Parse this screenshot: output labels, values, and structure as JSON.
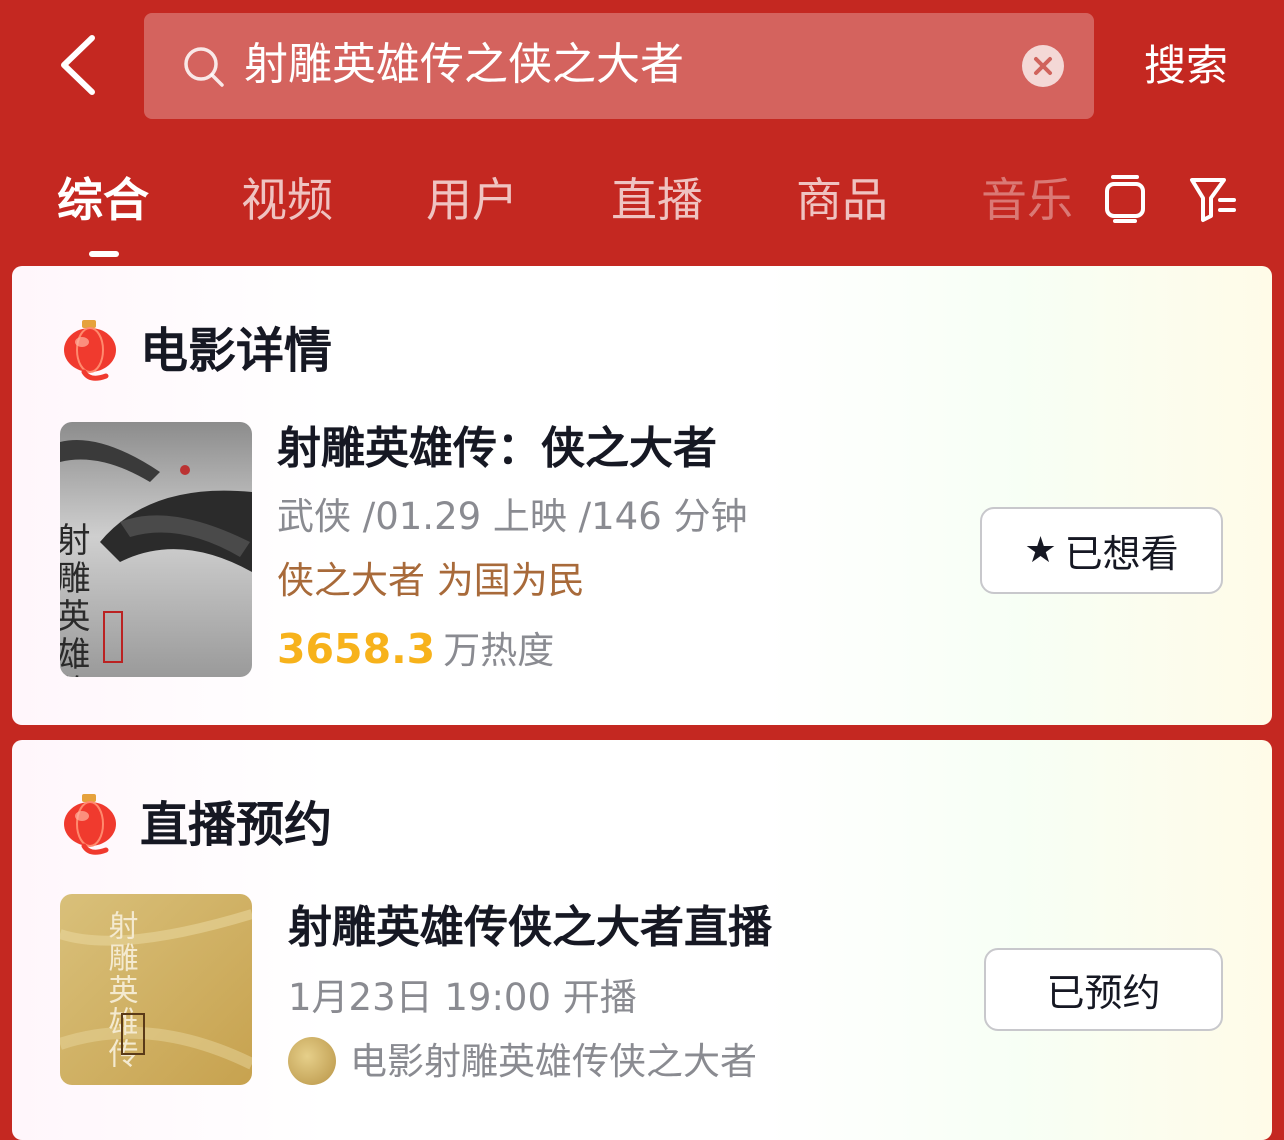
{
  "search": {
    "query": "射雕英雄传之侠之大者",
    "button_label": "搜索"
  },
  "tabs": [
    {
      "label": "综合"
    },
    {
      "label": "视频"
    },
    {
      "label": "用户"
    },
    {
      "label": "直播"
    },
    {
      "label": "商品"
    },
    {
      "label": "音乐"
    }
  ],
  "movie_card": {
    "section_title": "电影详情",
    "title": "射雕英雄传：侠之大者",
    "meta": "武侠 /01.29 上映 /146 分钟",
    "slogan": "侠之大者 为国为民",
    "heat_value": "3658.3",
    "heat_unit": "万热度",
    "button_label": "已想看"
  },
  "live_card": {
    "section_title": "直播预约",
    "title": "射雕英雄传侠之大者直播",
    "time": "1月23日 19:00 开播",
    "channel": "电影射雕英雄传侠之大者",
    "button_label": "已预约"
  },
  "poster_text": {
    "main": "射雕英雄传",
    "seal": "侠之大者"
  },
  "colors": {
    "brand_red": "#c42821",
    "heat_orange": "#f7b21b",
    "slogan_brown": "#a86a3a"
  }
}
